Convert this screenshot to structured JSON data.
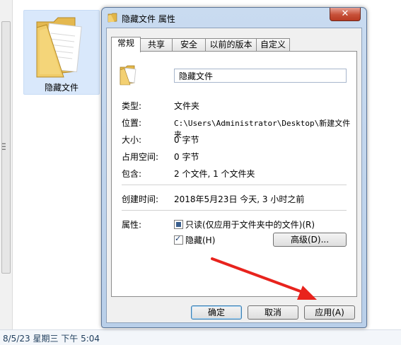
{
  "explorer": {
    "folder_label": "隐藏文件",
    "statusbar_text": "8/5/23 星期三 下午 5:04"
  },
  "dialog": {
    "title": "隐藏文件 属性",
    "close_symbol": "✕",
    "tabs": [
      {
        "label": "常规",
        "active": true
      },
      {
        "label": "共享",
        "active": false
      },
      {
        "label": "安全",
        "active": false
      },
      {
        "label": "以前的版本",
        "active": false
      },
      {
        "label": "自定义",
        "active": false
      }
    ],
    "name_value": "隐藏文件",
    "props": {
      "type_label": "类型:",
      "type_value": "文件夹",
      "location_label": "位置:",
      "location_value": "C:\\Users\\Administrator\\Desktop\\新建文件夹",
      "size_label": "大小:",
      "size_value": "0 字节",
      "disk_label": "占用空间:",
      "disk_value": "0 字节",
      "contains_label": "包含:",
      "contains_value": "2 个文件, 1 个文件夹",
      "created_label": "创建时间:",
      "created_value": "2018年5月23日 今天, 3 小时之前",
      "attr_label": "属性:"
    },
    "attributes": {
      "readonly_label": "只读(仅应用于文件夹中的文件)(R)",
      "readonly_state": "indeterminate",
      "hidden_label": "隐藏(H)",
      "hidden_checked": true,
      "advanced_label": "高级(D)..."
    },
    "buttons": {
      "ok": "确定",
      "cancel": "取消",
      "apply": "应用(A)"
    }
  },
  "annotation": {
    "arrow_color": "#e8231d"
  }
}
